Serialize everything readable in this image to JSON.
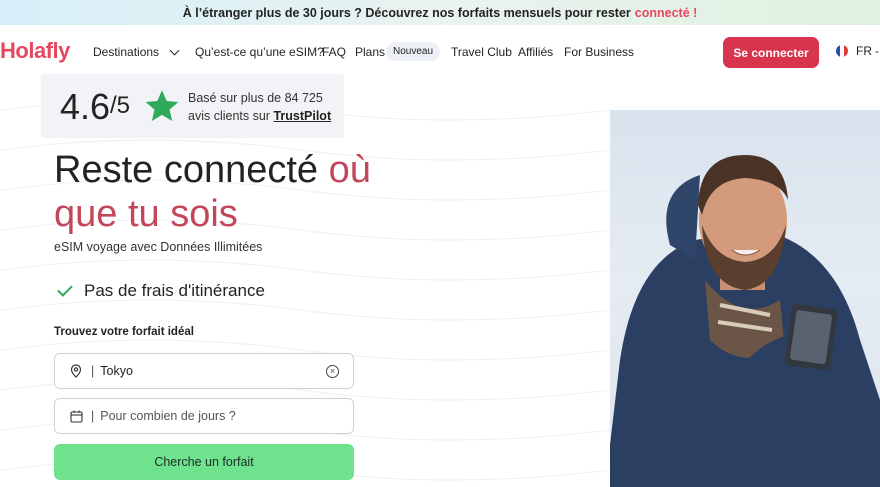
{
  "banner": {
    "text": "À l’étranger plus de 30 jours ? Découvrez nos forfaits mensuels pour rester",
    "accent": "connecté !"
  },
  "nav": {
    "logo": "Holafly",
    "items": [
      {
        "label": "Destinations"
      },
      {
        "label": "Qu’est-ce qu’une eSIM?"
      },
      {
        "label": "FAQ"
      },
      {
        "label": "Plans"
      },
      {
        "label": "Travel Club"
      },
      {
        "label": "Affiliés"
      },
      {
        "label": "For Business"
      }
    ],
    "new_badge": "Nouveau",
    "login": "Se connecter",
    "lang": "FR"
  },
  "rating": {
    "score": "4.6",
    "of": "/5",
    "line1": "Basé sur plus de 84 725",
    "line2": "avis clients sur",
    "source": "TrustPilot"
  },
  "hero": {
    "title_a": "Reste connecté",
    "title_b": "où",
    "title_c": "que tu sois",
    "subtitle": "eSIM voyage avec Données Illimitées",
    "feature": "Pas de frais d'itinérance"
  },
  "search": {
    "label": "Trouvez votre forfait idéal",
    "destination_value": "Tokyo",
    "days_placeholder": "Pour combien de jours ?",
    "button": "Cherche un forfait"
  },
  "colors": {
    "brand": "#e6485d",
    "cta": "#6fe28e",
    "login": "#d8344e",
    "check": "#2eaa4f"
  }
}
